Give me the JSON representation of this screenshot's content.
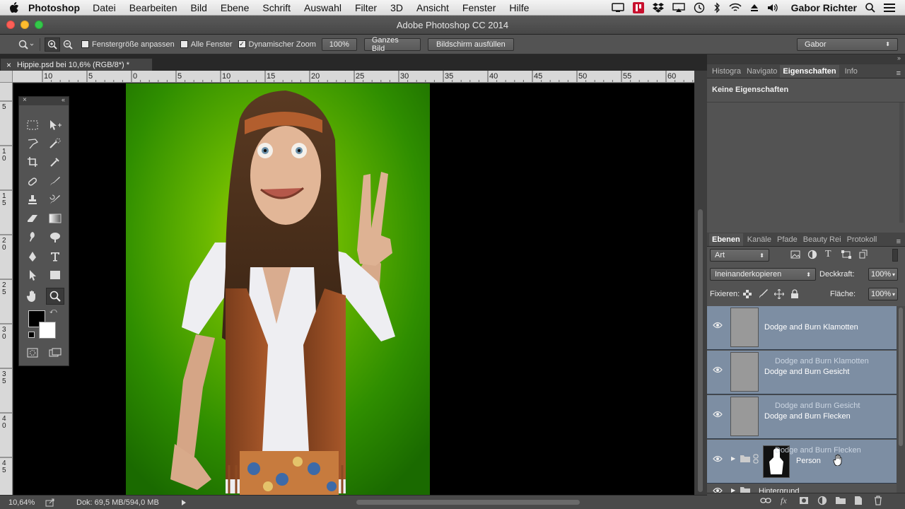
{
  "menubar": {
    "app_name": "Photoshop",
    "items": [
      "Datei",
      "Bearbeiten",
      "Bild",
      "Ebene",
      "Schrift",
      "Auswahl",
      "Filter",
      "3D",
      "Ansicht",
      "Fenster",
      "Hilfe"
    ],
    "user": "Gabor Richter"
  },
  "window": {
    "title": "Adobe Photoshop CC 2014"
  },
  "options": {
    "fit_window_label": "Fenstergröße anpassen",
    "all_windows_label": "Alle Fenster",
    "dynamic_zoom_label": "Dynamischer Zoom",
    "zoom100_label": "100%",
    "fit_screen_label": "Ganzes Bild",
    "fill_screen_label": "Bildschirm ausfüllen",
    "workspace": "Gabor",
    "dynamic_zoom_checked": true
  },
  "document": {
    "tab_title": "Hippie.psd bei 10,6% (RGB/8*) *"
  },
  "ruler_h": [
    "10",
    "5",
    "0",
    "5",
    "10",
    "15",
    "20",
    "25",
    "30",
    "35",
    "40",
    "45",
    "50",
    "55",
    "60"
  ],
  "ruler_v": [
    "5",
    "1\n0",
    "1\n5",
    "2\n0",
    "2\n5",
    "3\n0",
    "3\n5",
    "4\n0",
    "4\n5"
  ],
  "status": {
    "zoom": "10,64%",
    "doc": "Dok: 69,5 MB/594,0 MB"
  },
  "properties": {
    "tabs": [
      "Histogra",
      "Navigato",
      "Eigenschaften",
      "Info"
    ],
    "active_tab": "Eigenschaften",
    "content": "Keine Eigenschaften"
  },
  "layers_panel": {
    "tabs": [
      "Ebenen",
      "Kanäle",
      "Pfade",
      "Beauty Rei",
      "Protokoll"
    ],
    "active_tab": "Ebenen",
    "filter": "Art",
    "blend_mode": "Ineinanderkopieren",
    "opacity_label": "Deckkraft:",
    "opacity": "100%",
    "lock_label": "Fixieren:",
    "fill_label": "Fläche:",
    "fill": "100%",
    "layers": [
      {
        "name": "Dodge and Burn Klamotten"
      },
      {
        "name": "Dodge and Burn Gesicht",
        "ghost": "Dodge and Burn Klamotten"
      },
      {
        "name": "Dodge and Burn Flecken",
        "ghost": "Dodge and Burn Gesicht"
      },
      {
        "name": "Person",
        "ghost": "Dodge and Burn Flecken"
      }
    ],
    "partial_layer": "Hintergrund"
  },
  "colors": {
    "accent": "#7d8ea3",
    "panel": "#535353",
    "canvas_green": "#5aa600"
  }
}
